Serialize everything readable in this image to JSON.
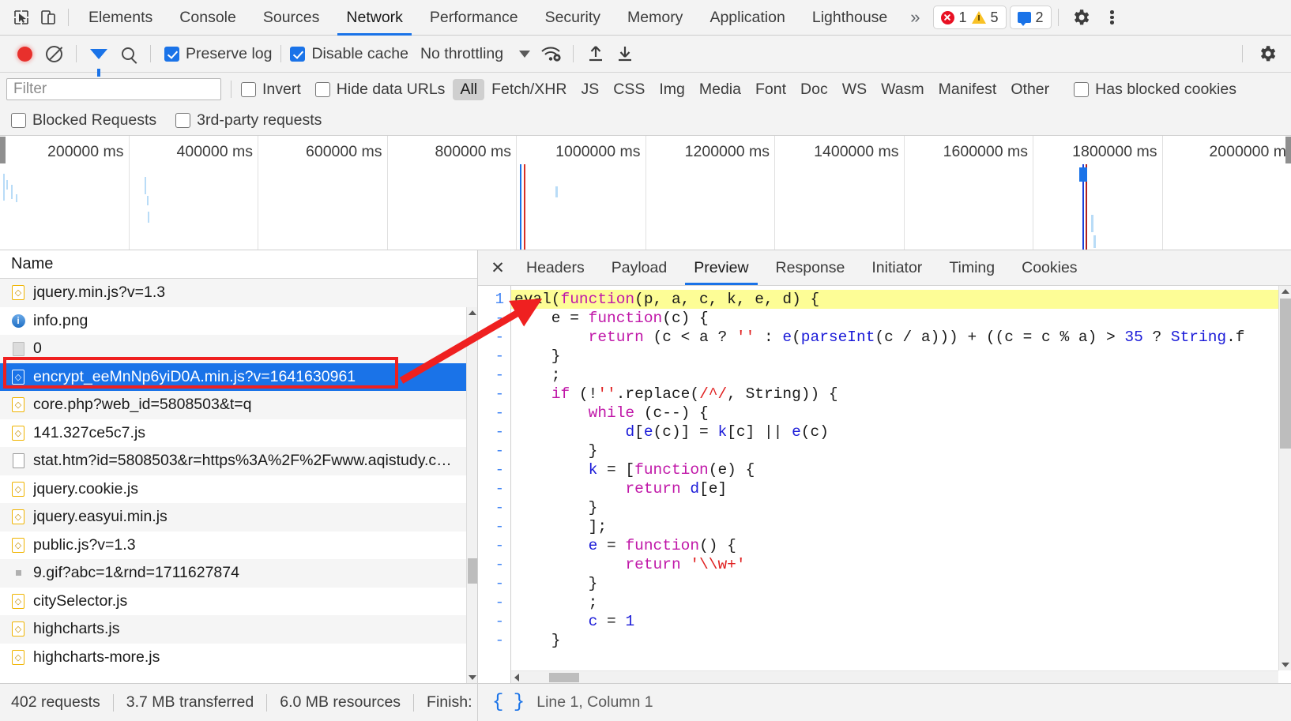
{
  "devtools": {
    "inspect_icon": "inspect-cursor-icon",
    "device_icon": "device-toolbar-icon",
    "tabs": [
      {
        "label": "Elements",
        "selected": false
      },
      {
        "label": "Console",
        "selected": false
      },
      {
        "label": "Sources",
        "selected": false
      },
      {
        "label": "Network",
        "selected": true
      },
      {
        "label": "Performance",
        "selected": false
      },
      {
        "label": "Security",
        "selected": false
      },
      {
        "label": "Memory",
        "selected": false
      },
      {
        "label": "Application",
        "selected": false
      },
      {
        "label": "Lighthouse",
        "selected": false
      }
    ],
    "more_tabs_label": "»",
    "error_count": "1",
    "warning_count": "5",
    "message_count": "2",
    "settings_icon": "gear-icon",
    "menu_icon": "kebab-menu-icon"
  },
  "network_toolbar": {
    "record_icon": "record-button-icon",
    "clear_icon": "clear-icon",
    "filter_icon": "filter-funnel-icon",
    "search_icon": "search-icon",
    "preserve_log_label": "Preserve log",
    "preserve_log_checked": true,
    "disable_cache_label": "Disable cache",
    "disable_cache_checked": true,
    "throttling_value": "No throttling",
    "network_conditions_icon": "wifi-settings-icon",
    "import_icon": "import-har-icon",
    "export_icon": "export-har-icon",
    "settings_icon": "network-settings-gear-icon"
  },
  "filter_bar": {
    "filter_placeholder": "Filter",
    "filter_value": "",
    "invert_label": "Invert",
    "invert_checked": false,
    "hide_data_urls_label": "Hide data URLs",
    "hide_data_urls_checked": false,
    "types": [
      {
        "label": "All",
        "active": true
      },
      {
        "label": "Fetch/XHR",
        "active": false
      },
      {
        "label": "JS",
        "active": false
      },
      {
        "label": "CSS",
        "active": false
      },
      {
        "label": "Img",
        "active": false
      },
      {
        "label": "Media",
        "active": false
      },
      {
        "label": "Font",
        "active": false
      },
      {
        "label": "Doc",
        "active": false
      },
      {
        "label": "WS",
        "active": false
      },
      {
        "label": "Wasm",
        "active": false
      },
      {
        "label": "Manifest",
        "active": false
      },
      {
        "label": "Other",
        "active": false
      }
    ],
    "has_blocked_cookies_label": "Has blocked cookies",
    "has_blocked_cookies_checked": false,
    "blocked_requests_label": "Blocked Requests",
    "blocked_requests_checked": false,
    "third_party_label": "3rd-party requests",
    "third_party_checked": false
  },
  "overview": {
    "ticks": [
      "200000 ms",
      "400000 ms",
      "600000 ms",
      "800000 ms",
      "1000000 ms",
      "1200000 ms",
      "1400000 ms",
      "1600000 ms",
      "1800000 ms",
      "2000000 m"
    ],
    "dom_content_loaded_color": "#1a73e8",
    "load_event_color": "#d93025",
    "request_bar_color": "#b9dcf7"
  },
  "request_list": {
    "column_header": "Name",
    "rows": [
      {
        "name": "jquery.min.js?v=1.3",
        "icon": "js-file-icon",
        "selected": false
      },
      {
        "name": "info.png",
        "icon": "image-file-icon",
        "selected": false
      },
      {
        "name": "0",
        "icon": "generic-file-icon",
        "selected": false
      },
      {
        "name": "encrypt_eeMnNp6yiD0A.min.js?v=1641630961",
        "icon": "js-file-icon",
        "selected": true
      },
      {
        "name": "core.php?web_id=5808503&t=q",
        "icon": "js-file-icon",
        "selected": false
      },
      {
        "name": "141.327ce5c7.js",
        "icon": "js-file-icon",
        "selected": false
      },
      {
        "name": "stat.htm?id=5808503&r=https%3A%2F%2Fwww.aqistudy.c…",
        "icon": "html-file-icon",
        "selected": false
      },
      {
        "name": "jquery.cookie.js",
        "icon": "js-file-icon",
        "selected": false
      },
      {
        "name": "jquery.easyui.min.js",
        "icon": "js-file-icon",
        "selected": false
      },
      {
        "name": "public.js?v=1.3",
        "icon": "js-file-icon",
        "selected": false
      },
      {
        "name": "9.gif?abc=1&rnd=1711627874",
        "icon": "dot-file-icon",
        "selected": false
      },
      {
        "name": "citySelector.js",
        "icon": "js-file-icon",
        "selected": false
      },
      {
        "name": "highcharts.js",
        "icon": "js-file-icon",
        "selected": false
      },
      {
        "name": "highcharts-more.js",
        "icon": "js-file-icon",
        "selected": false
      }
    ]
  },
  "detail_panel": {
    "close_icon": "close-icon",
    "tabs": [
      {
        "label": "Headers",
        "selected": false
      },
      {
        "label": "Payload",
        "selected": false
      },
      {
        "label": "Preview",
        "selected": true
      },
      {
        "label": "Response",
        "selected": false
      },
      {
        "label": "Initiator",
        "selected": false
      },
      {
        "label": "Timing",
        "selected": false
      },
      {
        "label": "Cookies",
        "selected": false
      }
    ],
    "line_numbers": [
      "1",
      "-",
      "-",
      "-",
      "-",
      "-",
      "-",
      "-",
      "-",
      "-",
      "-",
      "-",
      "-",
      "-",
      "-",
      "-",
      "-",
      "-",
      "-"
    ],
    "code_lines": [
      {
        "highlighted": true,
        "tokens": [
          {
            "t": "eval(",
            "c": "pun"
          },
          {
            "t": "function",
            "c": "kw"
          },
          {
            "t": "(p, a, c, k, e, d) {",
            "c": "pun"
          }
        ]
      },
      {
        "highlighted": false,
        "tokens": [
          {
            "t": "    e = ",
            "c": "pun"
          },
          {
            "t": "function",
            "c": "kw"
          },
          {
            "t": "(c) {",
            "c": "pun"
          }
        ]
      },
      {
        "highlighted": false,
        "tokens": [
          {
            "t": "        ",
            "c": "pun"
          },
          {
            "t": "return",
            "c": "kw"
          },
          {
            "t": " (c < a ? ",
            "c": "pun"
          },
          {
            "t": "''",
            "c": "str"
          },
          {
            "t": " : ",
            "c": "pun"
          },
          {
            "t": "e",
            "c": "id"
          },
          {
            "t": "(",
            "c": "pun"
          },
          {
            "t": "parseInt",
            "c": "id"
          },
          {
            "t": "(c / a))) + ((c = c % a) > ",
            "c": "pun"
          },
          {
            "t": "35",
            "c": "num"
          },
          {
            "t": " ? ",
            "c": "pun"
          },
          {
            "t": "String",
            "c": "id"
          },
          {
            "t": ".f",
            "c": "pun"
          }
        ]
      },
      {
        "highlighted": false,
        "tokens": [
          {
            "t": "    }",
            "c": "pun"
          }
        ]
      },
      {
        "highlighted": false,
        "tokens": [
          {
            "t": "    ;",
            "c": "pun"
          }
        ]
      },
      {
        "highlighted": false,
        "tokens": [
          {
            "t": "    ",
            "c": "pun"
          },
          {
            "t": "if",
            "c": "kw"
          },
          {
            "t": " (!",
            "c": "pun"
          },
          {
            "t": "''",
            "c": "str"
          },
          {
            "t": ".replace(",
            "c": "pun"
          },
          {
            "t": "/^/",
            "c": "str"
          },
          {
            "t": ", ",
            "c": "pun"
          },
          {
            "t": "String",
            "c": "pun"
          },
          {
            "t": ")) {",
            "c": "pun"
          }
        ]
      },
      {
        "highlighted": false,
        "tokens": [
          {
            "t": "        ",
            "c": "pun"
          },
          {
            "t": "while",
            "c": "kw"
          },
          {
            "t": " (c--) {",
            "c": "pun"
          }
        ]
      },
      {
        "highlighted": false,
        "tokens": [
          {
            "t": "            ",
            "c": "pun"
          },
          {
            "t": "d",
            "c": "id"
          },
          {
            "t": "[",
            "c": "pun"
          },
          {
            "t": "e",
            "c": "id"
          },
          {
            "t": "(c)] = ",
            "c": "pun"
          },
          {
            "t": "k",
            "c": "id"
          },
          {
            "t": "[c] || ",
            "c": "pun"
          },
          {
            "t": "e",
            "c": "id"
          },
          {
            "t": "(c)",
            "c": "pun"
          }
        ]
      },
      {
        "highlighted": false,
        "tokens": [
          {
            "t": "        }",
            "c": "pun"
          }
        ]
      },
      {
        "highlighted": false,
        "tokens": [
          {
            "t": "        ",
            "c": "pun"
          },
          {
            "t": "k",
            "c": "id"
          },
          {
            "t": " = [",
            "c": "pun"
          },
          {
            "t": "function",
            "c": "kw"
          },
          {
            "t": "(e) {",
            "c": "pun"
          }
        ]
      },
      {
        "highlighted": false,
        "tokens": [
          {
            "t": "            ",
            "c": "pun"
          },
          {
            "t": "return",
            "c": "kw"
          },
          {
            "t": " ",
            "c": "pun"
          },
          {
            "t": "d",
            "c": "id"
          },
          {
            "t": "[e]",
            "c": "pun"
          }
        ]
      },
      {
        "highlighted": false,
        "tokens": [
          {
            "t": "        }",
            "c": "pun"
          }
        ]
      },
      {
        "highlighted": false,
        "tokens": [
          {
            "t": "        ];",
            "c": "pun"
          }
        ]
      },
      {
        "highlighted": false,
        "tokens": [
          {
            "t": "        ",
            "c": "pun"
          },
          {
            "t": "e",
            "c": "id"
          },
          {
            "t": " = ",
            "c": "pun"
          },
          {
            "t": "function",
            "c": "kw"
          },
          {
            "t": "() {",
            "c": "pun"
          }
        ]
      },
      {
        "highlighted": false,
        "tokens": [
          {
            "t": "            ",
            "c": "pun"
          },
          {
            "t": "return",
            "c": "kw"
          },
          {
            "t": " ",
            "c": "pun"
          },
          {
            "t": "'\\\\w+'",
            "c": "str"
          }
        ]
      },
      {
        "highlighted": false,
        "tokens": [
          {
            "t": "        }",
            "c": "pun"
          }
        ]
      },
      {
        "highlighted": false,
        "tokens": [
          {
            "t": "        ;",
            "c": "pun"
          }
        ]
      },
      {
        "highlighted": false,
        "tokens": [
          {
            "t": "        ",
            "c": "pun"
          },
          {
            "t": "c",
            "c": "id"
          },
          {
            "t": " = ",
            "c": "pun"
          },
          {
            "t": "1",
            "c": "num"
          }
        ]
      },
      {
        "highlighted": false,
        "tokens": [
          {
            "t": "    }",
            "c": "pun"
          }
        ]
      }
    ]
  },
  "status_bar": {
    "requests": "402 requests",
    "transferred": "3.7 MB transferred",
    "resources": "6.0 MB resources",
    "finish": "Finish:",
    "format_icon": "pretty-print-braces-icon",
    "cursor_position": "Line 1, Column 1"
  },
  "annotation": {
    "highlight_color": "#ef2020",
    "target": "encrypt_eeMnNp6yiD0A.min.js?v=1641630961"
  }
}
